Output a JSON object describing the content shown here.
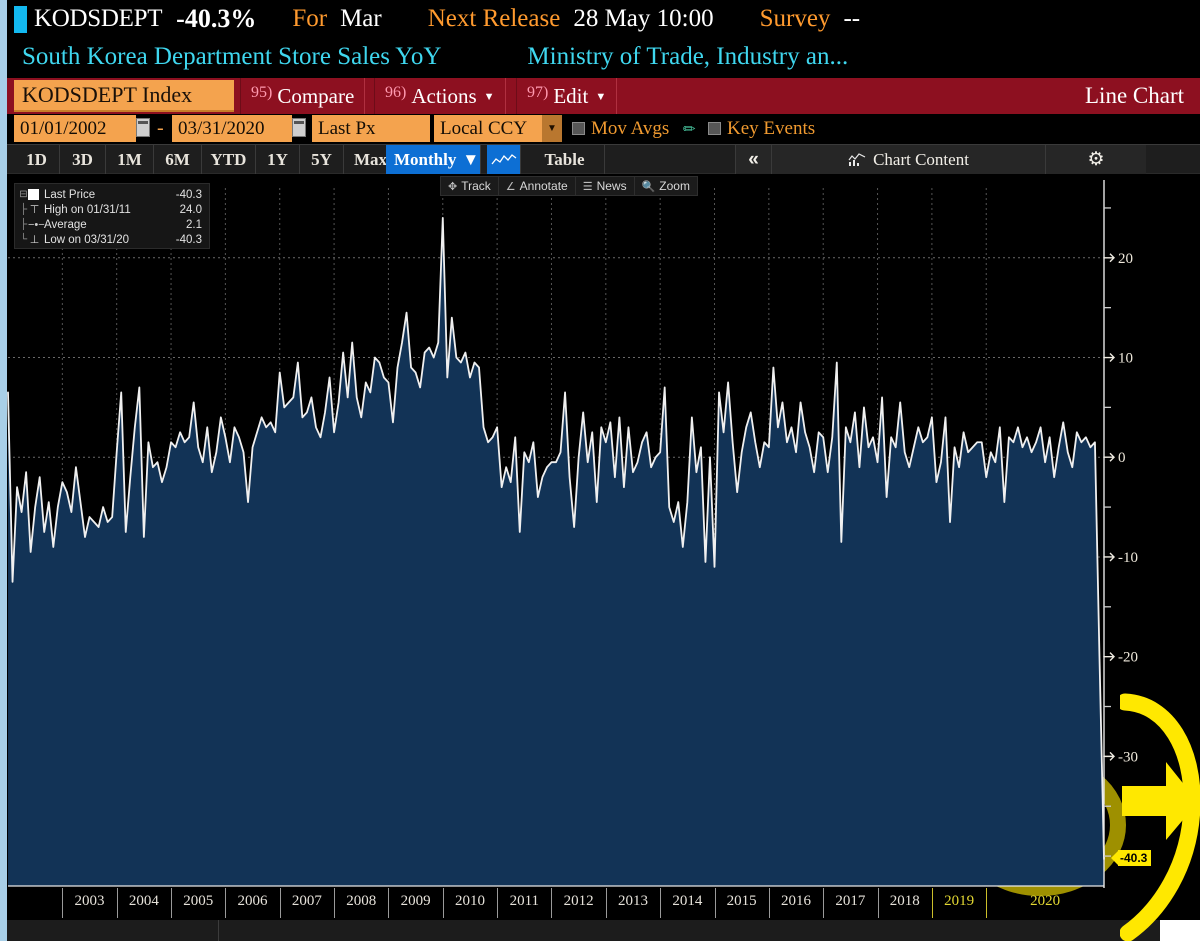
{
  "header": {
    "ticker": "KODSDEPT",
    "value": "-40.3%",
    "for_label": "For",
    "for_value": "Mar",
    "next_release_label": "Next Release",
    "next_release_value": "28 May 10:00",
    "survey_label": "Survey",
    "survey_value": "--",
    "description": "South Korea Department Store Sales YoY",
    "source": "Ministry of Trade, Industry an..."
  },
  "command_bar": {
    "security_field": "KODSDEPT Index",
    "buttons": [
      {
        "num": "95)",
        "label": "Compare",
        "has_caret": false
      },
      {
        "num": "96)",
        "label": "Actions",
        "has_caret": true
      },
      {
        "num": "97)",
        "label": "Edit",
        "has_caret": true
      }
    ],
    "chart_type": "Line Chart"
  },
  "param_bar": {
    "date_from": "01/01/2002",
    "separator": "-",
    "date_to": "03/31/2020",
    "price_type": "Last Px",
    "currency": "Local CCY",
    "mov_avgs_label": "Mov Avgs",
    "key_events_label": "Key Events"
  },
  "period_bar": {
    "periods": [
      "1D",
      "3D",
      "1M",
      "6M",
      "YTD",
      "1Y",
      "5Y",
      "Max"
    ],
    "frequency": "Monthly",
    "frequency_caret": "▼",
    "table_label": "Table",
    "collapse_label": "«",
    "chart_content_label": "Chart Content",
    "gear_label": "⚙"
  },
  "chart_toolbar": {
    "items": [
      {
        "icon": "track-icon",
        "label": "Track"
      },
      {
        "icon": "annotate-icon",
        "label": "Annotate"
      },
      {
        "icon": "news-icon",
        "label": "News"
      },
      {
        "icon": "zoom-icon",
        "label": "Zoom"
      }
    ]
  },
  "legend": {
    "rows": [
      {
        "glyph": "swatch",
        "name": "Last Price",
        "value": "-40.3"
      },
      {
        "glyph": "⊤",
        "name": "High on 01/31/11",
        "value": "24.0"
      },
      {
        "glyph": "•",
        "name": "Average",
        "value": "2.1"
      },
      {
        "glyph": "⊥",
        "name": "Low on 03/31/20",
        "value": "-40.3"
      }
    ]
  },
  "last_price_flag": "-40.3",
  "colors": {
    "accent_orange": "#f4a34e",
    "command_red": "#8d1020",
    "cyan": "#3fd7ef",
    "select_blue": "#0d6fd4",
    "area_fill": "#123356",
    "line": "#f0f0f0",
    "last_flag": "#ffe800",
    "annotation": "#ffe800"
  },
  "chart_data": {
    "type": "line",
    "title": "South Korea Department Store Sales YoY",
    "subtitle": "KODSDEPT Index — Monthly",
    "xlabel": "",
    "ylabel": "",
    "ylim": [
      -43,
      27
    ],
    "xlim": [
      "2002-01",
      "2020-03"
    ],
    "grid": true,
    "legend_position": "top-left",
    "y_ticks": [
      20,
      10,
      0,
      -10,
      -20,
      -30
    ],
    "y_minor_ticks": [
      25,
      15,
      5,
      -5,
      -15,
      -25,
      -35,
      -40
    ],
    "x_tick_labels": [
      "2003",
      "2004",
      "2005",
      "2006",
      "2007",
      "2008",
      "2009",
      "2010",
      "2011",
      "2012",
      "2013",
      "2014",
      "2015",
      "2016",
      "2017",
      "2018",
      "2019",
      "2020"
    ],
    "x_tick_highlighted": [
      "2019",
      "2020"
    ],
    "annotations": [
      {
        "type": "last-value-flag",
        "text": "-40.3",
        "y": -40.3
      },
      {
        "type": "hand-drawn-ellipse",
        "color": "#ffe800",
        "note": "circle around the final plunge"
      },
      {
        "type": "hand-drawn-arrow",
        "color": "#ffe800",
        "note": "arrow pointing at last value"
      }
    ],
    "stats": {
      "high": 24.0,
      "high_date": "01/31/11",
      "low": -40.3,
      "low_date": "03/31/20",
      "average": 2.1,
      "last": -40.3
    },
    "series": [
      {
        "name": "Last Price",
        "color": "#f0f0f0",
        "fill": "#123356",
        "start": "2002-01",
        "frequency": "monthly",
        "values": [
          6.5,
          -12.5,
          -3.0,
          -5.5,
          -1.5,
          -9.5,
          -5.0,
          -2.0,
          -7.5,
          -4.5,
          -9.0,
          -5.0,
          -2.5,
          -3.5,
          -5.5,
          -1.0,
          -4.5,
          -8.0,
          -6.0,
          -6.5,
          -7.0,
          -5.0,
          -6.5,
          -6.0,
          0.5,
          6.5,
          -7.5,
          -2.0,
          3.0,
          7.0,
          -8.0,
          1.5,
          -1.0,
          -0.5,
          -2.5,
          -1.0,
          1.5,
          1.0,
          2.5,
          1.5,
          2.0,
          5.5,
          1.0,
          -0.5,
          3.0,
          -1.5,
          0.5,
          4.0,
          2.0,
          -0.5,
          3.0,
          2.0,
          0.5,
          -4.5,
          1.0,
          2.5,
          4.0,
          3.0,
          3.5,
          2.5,
          8.5,
          5.0,
          5.5,
          6.0,
          9.5,
          4.0,
          4.5,
          6.0,
          3.0,
          2.0,
          4.5,
          8.0,
          2.5,
          5.5,
          10.5,
          6.0,
          11.5,
          6.0,
          4.0,
          7.5,
          6.5,
          10.0,
          9.5,
          8.0,
          7.5,
          3.5,
          9.0,
          11.5,
          14.5,
          9.0,
          8.5,
          7.0,
          10.5,
          11.0,
          10.0,
          11.5,
          24.0,
          8.0,
          14.0,
          10.0,
          9.5,
          10.5,
          8.0,
          9.5,
          9.0,
          3.0,
          1.5,
          2.0,
          3.0,
          -3.0,
          -1.0,
          -2.5,
          2.0,
          -7.5,
          0.5,
          -0.5,
          1.5,
          -4.0,
          -2.0,
          -1.0,
          -0.5,
          -0.5,
          0.5,
          6.5,
          -2.0,
          -7.0,
          0.0,
          4.5,
          -0.5,
          2.5,
          -4.5,
          3.0,
          1.5,
          3.5,
          -2.0,
          4.0,
          -3.0,
          3.0,
          -1.5,
          -0.5,
          1.5,
          2.5,
          -1.0,
          0.0,
          0.5,
          7.0,
          -5.0,
          -6.5,
          -4.5,
          -9.0,
          -4.5,
          4.0,
          -1.5,
          1.0,
          -10.5,
          0.0,
          -11.0,
          6.5,
          2.5,
          7.5,
          1.5,
          -3.5,
          0.5,
          3.0,
          4.5,
          1.5,
          -1.0,
          1.5,
          1.0,
          9.0,
          3.0,
          5.5,
          1.5,
          3.0,
          0.5,
          5.5,
          2.5,
          1.0,
          -1.5,
          2.5,
          2.0,
          -1.5,
          2.0,
          9.5,
          -8.5,
          3.0,
          1.5,
          4.5,
          -1.0,
          5.0,
          1.0,
          2.0,
          -0.5,
          6.0,
          -4.0,
          2.0,
          1.0,
          5.5,
          0.5,
          -1.0,
          1.0,
          3.0,
          1.5,
          2.0,
          4.0,
          -2.5,
          -0.5,
          4.0,
          -6.5,
          1.0,
          -1.0,
          2.5,
          0.5,
          1.0,
          1.5,
          1.5,
          -2.0,
          0.5,
          -0.5,
          3.0,
          -4.5,
          2.0,
          1.5,
          3.0,
          1.0,
          2.0,
          0.5,
          1.5,
          3.0,
          -0.5,
          2.0,
          -2.0,
          1.0,
          3.5,
          0.5,
          -1.0,
          2.5,
          1.5,
          2.0,
          1.0,
          1.5,
          -20.0,
          -40.3
        ]
      }
    ]
  }
}
